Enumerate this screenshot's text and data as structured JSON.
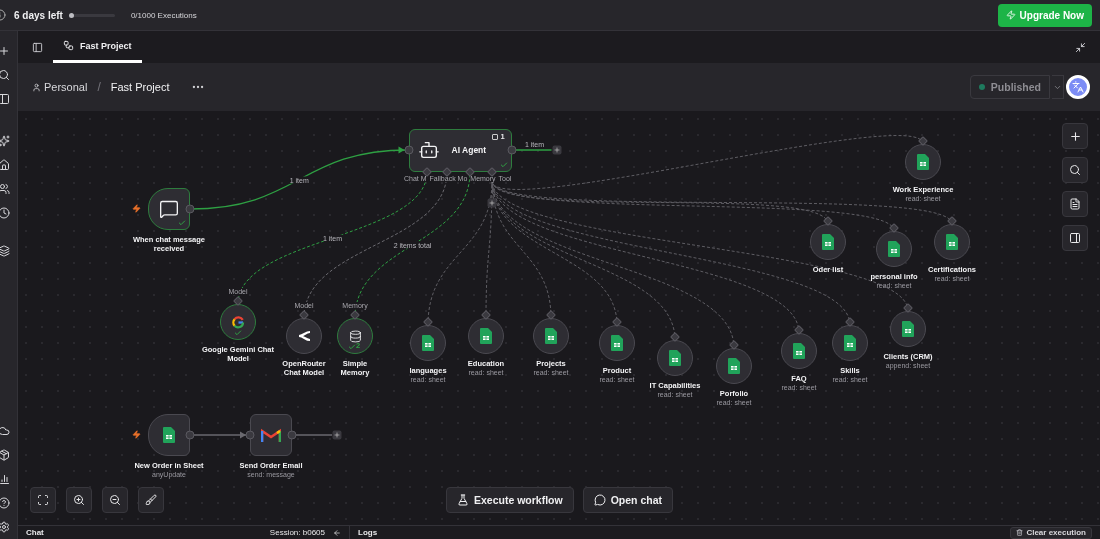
{
  "top_bar": {
    "trial": "6 days left",
    "level": 0,
    "executions": "0/1000 Executions",
    "upgrade": "Upgrade Now"
  },
  "tabs": [
    {
      "label": "Fast Project",
      "selected": true
    }
  ],
  "breadcrumb": {
    "project": "Personal",
    "separator": "/",
    "workflow": "Fast Project"
  },
  "publish": {
    "label": "Published",
    "published": true
  },
  "agent_handles": [
    "Chat M",
    "Fallback Mo",
    "Memory",
    "Tool"
  ],
  "nodes": [
    {
      "kind": "trigger",
      "title": "When chat message received",
      "success": true
    },
    {
      "kind": "agent",
      "title": "AI Agent",
      "badge": "1",
      "success": true,
      "output_label": "1 item"
    },
    {
      "kind": "sub",
      "title": "Work Experience",
      "subtitle": "read: sheet",
      "success": false
    },
    {
      "kind": "sub",
      "title": "Oder list",
      "success": false
    },
    {
      "kind": "sub",
      "title": "personal info",
      "subtitle": "read: sheet",
      "success": false
    },
    {
      "kind": "sub",
      "title": "Certifications",
      "subtitle": "read: sheet",
      "success": false
    },
    {
      "kind": "sub",
      "title": "Google Gemini Chat Model",
      "input_label": "Model",
      "success": true
    },
    {
      "kind": "sub",
      "title": "OpenRouter Chat Model",
      "input_label": "Model",
      "success": false
    },
    {
      "kind": "sub",
      "title": "Simple Memory",
      "input_label": "Memory",
      "success": true,
      "runs": "2"
    },
    {
      "kind": "sub",
      "title": "languages",
      "subtitle": "read: sheet",
      "success": false
    },
    {
      "kind": "sub",
      "title": "Education",
      "subtitle": "read: sheet",
      "success": false
    },
    {
      "kind": "sub",
      "title": "Projects",
      "subtitle": "read: sheet",
      "success": false
    },
    {
      "kind": "sub",
      "title": "Product",
      "subtitle": "read: sheet",
      "success": false
    },
    {
      "kind": "sub",
      "title": "IT Capabilities",
      "subtitle": "read: sheet",
      "success": false
    },
    {
      "kind": "sub",
      "title": "Porfolio",
      "subtitle": "read: sheet",
      "success": false
    },
    {
      "kind": "sub",
      "title": "FAQ",
      "subtitle": "read: sheet",
      "success": false
    },
    {
      "kind": "sub",
      "title": "Skills",
      "subtitle": "read: sheet",
      "success": false
    },
    {
      "kind": "sub",
      "title": "Clients (CRM)",
      "subtitle": "append: sheet",
      "success": false
    },
    {
      "kind": "trigger",
      "title": "New Order in Sheet",
      "subtitle": "anyUpdate",
      "success": false
    },
    {
      "kind": "action",
      "title": "Send Order Email",
      "subtitle": "send: message",
      "success": false
    }
  ],
  "edges": [
    {
      "active": true,
      "label": "1 item"
    },
    {
      "active": true,
      "label": "1 item"
    },
    {
      "active": false
    },
    {
      "active": true,
      "label": "2 items total"
    },
    {
      "active": false
    }
  ],
  "execute_button": "Execute workflow",
  "chat_button": "Open chat",
  "bottom_panel": {
    "chat": "Chat",
    "session": "Session: b0605",
    "logs": "Logs",
    "clear": "Clear execution"
  }
}
